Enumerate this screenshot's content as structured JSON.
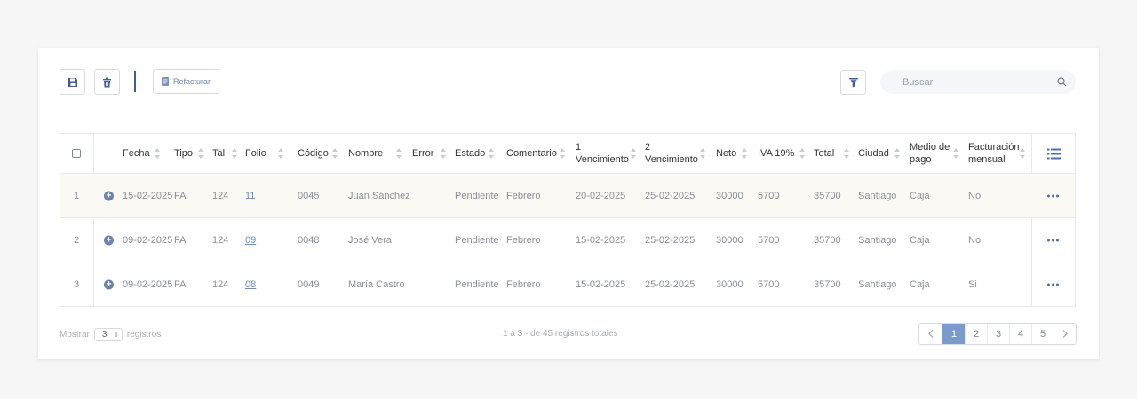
{
  "toolbar": {
    "refacturar_label": "Refacturar",
    "search_placeholder": "Buscar"
  },
  "columns": [
    {
      "label": "Fecha"
    },
    {
      "label": "Tipo"
    },
    {
      "label": "Tal"
    },
    {
      "label": "Folio"
    },
    {
      "label": "Código"
    },
    {
      "label": "Nombre"
    },
    {
      "label": "Error"
    },
    {
      "label": "Estado"
    },
    {
      "label": "Comentario"
    },
    {
      "label": "1 Vencimiento"
    },
    {
      "label": "2 Vencimiento"
    },
    {
      "label": "Neto"
    },
    {
      "label": "IVA 19%"
    },
    {
      "label": "Total"
    },
    {
      "label": "Ciudad"
    },
    {
      "label": "Medio de pago"
    },
    {
      "label": "Facturación mensual"
    }
  ],
  "rows": [
    {
      "index": "1",
      "fecha": "15-02-2025",
      "tipo": "FA",
      "tal": "124",
      "folio": "11",
      "codigo": "0045",
      "nombre": "Juan Sánchez",
      "error": "",
      "estado": "Pendiente",
      "comentario": "Febrero",
      "venc1": "20-02-2025",
      "venc2": "25-02-2025",
      "neto": "30000",
      "iva": "5700",
      "total": "35700",
      "ciudad": "Santiago",
      "medio": "Caja",
      "mensual": "No"
    },
    {
      "index": "2",
      "fecha": "09-02-2025",
      "tipo": "FA",
      "tal": "124",
      "folio": "09",
      "codigo": "0048",
      "nombre": "José Vera",
      "error": "",
      "estado": "Pendiente",
      "comentario": "Febrero",
      "venc1": "15-02-2025",
      "venc2": "25-02-2025",
      "neto": "30000",
      "iva": "5700",
      "total": "35700",
      "ciudad": "Santiago",
      "medio": "Caja",
      "mensual": "No"
    },
    {
      "index": "3",
      "fecha": "09-02-2025",
      "tipo": "FA",
      "tal": "124",
      "folio": "08",
      "codigo": "0049",
      "nombre": "María Castro",
      "error": "",
      "estado": "Pendiente",
      "comentario": "Febrero",
      "venc1": "15-02-2025",
      "venc2": "25-02-2025",
      "neto": "30000",
      "iva": "5700",
      "total": "35700",
      "ciudad": "Santiago",
      "medio": "Caja",
      "mensual": "Si"
    }
  ],
  "footer": {
    "mostrar_label": "Mostrar",
    "page_size": "3",
    "registros_label": "registros",
    "summary": "1 a 3 - de 45 registros totales",
    "pages": [
      "1",
      "2",
      "3",
      "4",
      "5"
    ],
    "current_page": "1"
  },
  "colors": {
    "accent": "#3e5f93",
    "active_page": "#7b9ace",
    "row_highlight": "#fbf9f4"
  }
}
